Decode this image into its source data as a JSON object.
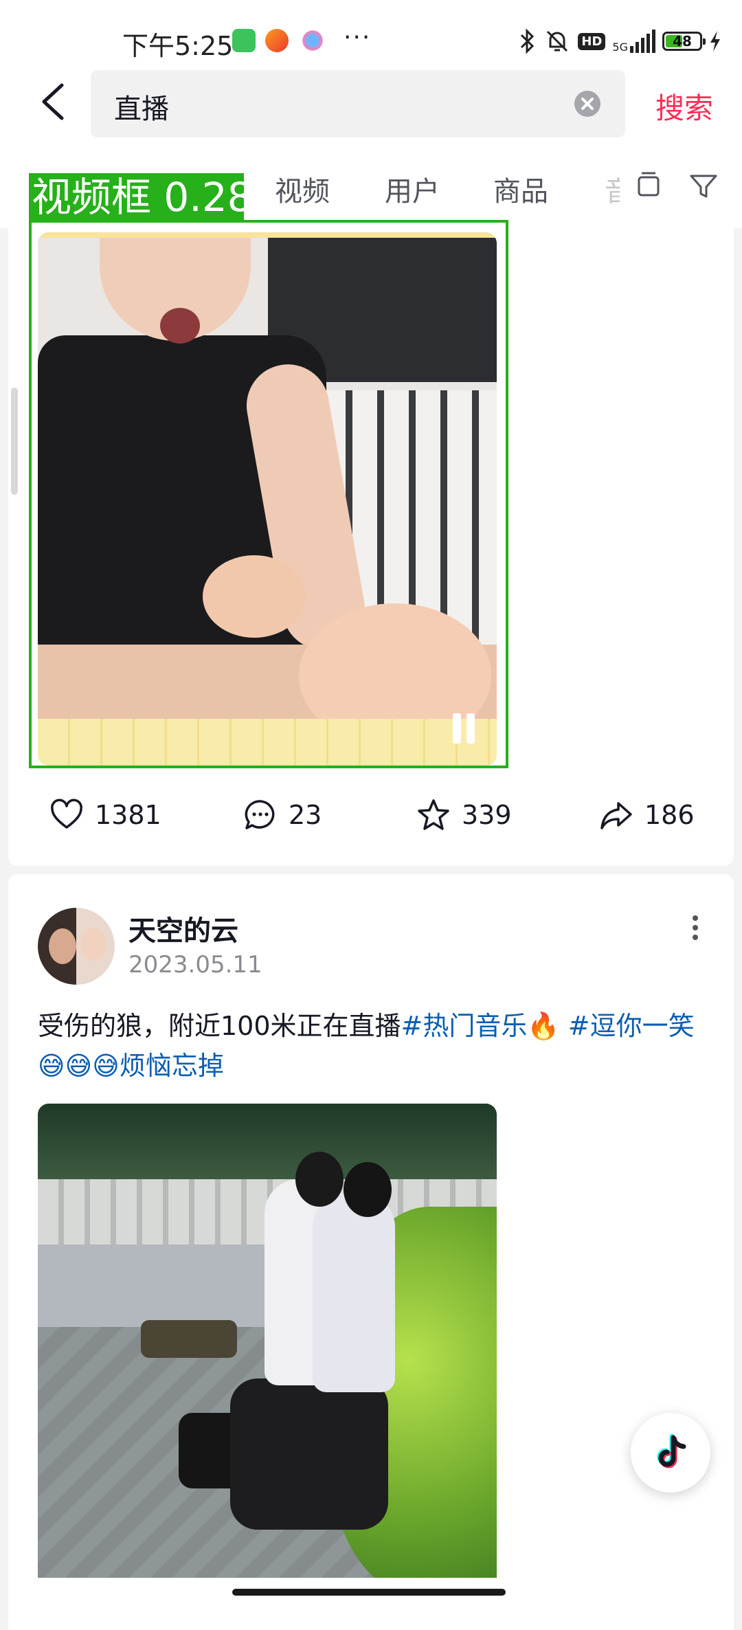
{
  "status_bar": {
    "time": "下午5:25",
    "icons": [
      "wechat-icon",
      "58-app-icon",
      "cloud-app-icon",
      "more-dots-icon",
      "bluetooth-icon",
      "mute-bell-icon",
      "hd-icon",
      "5g-signal-icon",
      "battery-icon",
      "charging-icon"
    ],
    "dots": "···",
    "hd": "HD",
    "network": "5G",
    "battery": "48",
    "colors": {
      "battery_fill": "#3cb522"
    }
  },
  "search": {
    "query": "直播",
    "submit_label": "搜索",
    "accent": "#fe2c55"
  },
  "tabs": {
    "items": [
      "视频",
      "用户",
      "商品"
    ],
    "partial": "音"
  },
  "detection": {
    "label": "视频框 0.28",
    "color": "#26b01a"
  },
  "post1": {
    "likes": "1381",
    "comments": "23",
    "favorites": "339",
    "shares": "186"
  },
  "post2": {
    "author": "天空的云",
    "date": "2023.05.11",
    "caption_plain": "受伤的狼，附近100米正在直播",
    "hashtags": [
      "#热门音乐🔥",
      "#逗你一笑😅😅😅烦恼忘掉"
    ],
    "tag_color": "#0b5db2"
  }
}
